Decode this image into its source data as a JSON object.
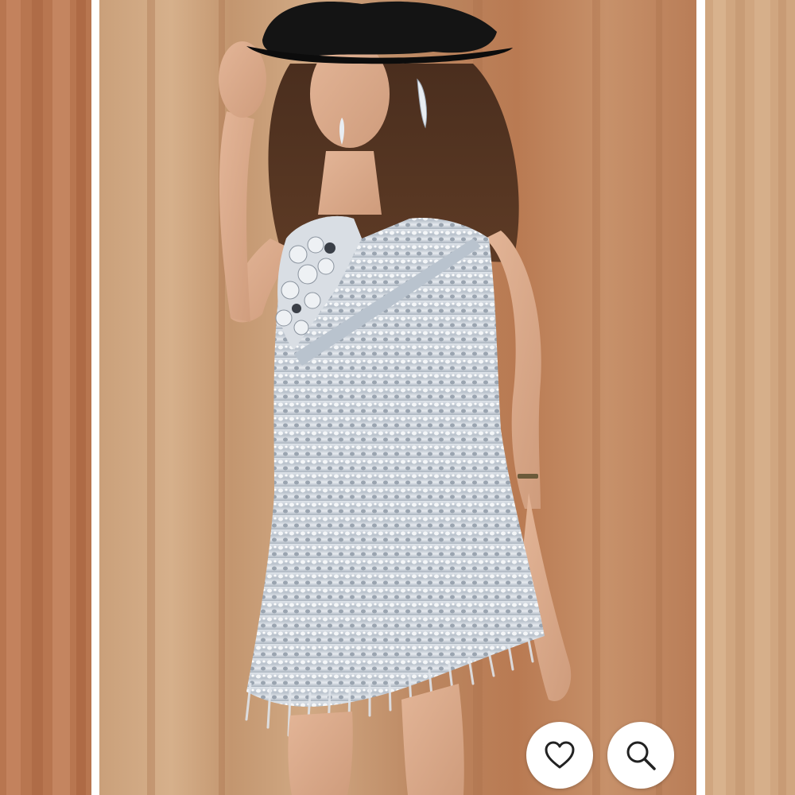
{
  "gallery": {
    "photo_alt": "",
    "colors": {
      "backdrop_left": "#b4714a",
      "backdrop_main": "#c9a07c",
      "backdrop_right": "#d3ab85",
      "sequin_silver": "#c9d0d8",
      "hat_black": "#141414",
      "button_bg": "#ffffff",
      "icon_stroke": "#222222"
    },
    "actions": {
      "like_icon": "heart-icon",
      "zoom_icon": "magnifier-icon"
    }
  }
}
